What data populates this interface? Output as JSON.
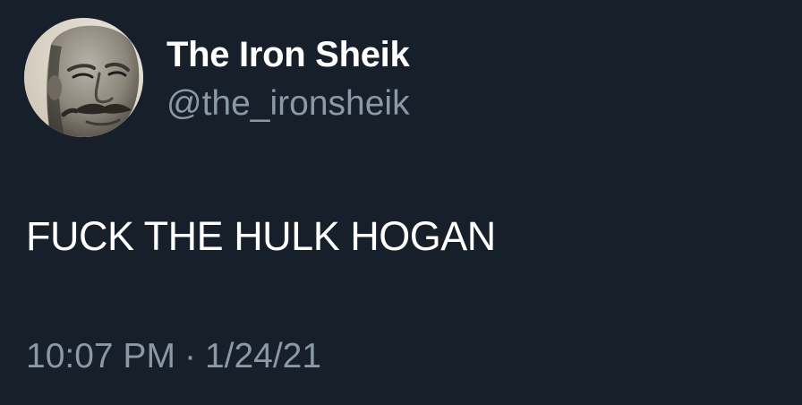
{
  "tweet": {
    "author": {
      "display_name": "The Iron Sheik",
      "handle": "@the_ironsheik",
      "avatar_icon": "profile-photo"
    },
    "text": "FUCK THE HULK HOGAN",
    "time": "10:07 PM",
    "separator": "·",
    "date": "1/24/21"
  },
  "colors": {
    "background": "#161f2a",
    "primary_text": "#ffffff",
    "secondary_text": "#8b98a5"
  }
}
